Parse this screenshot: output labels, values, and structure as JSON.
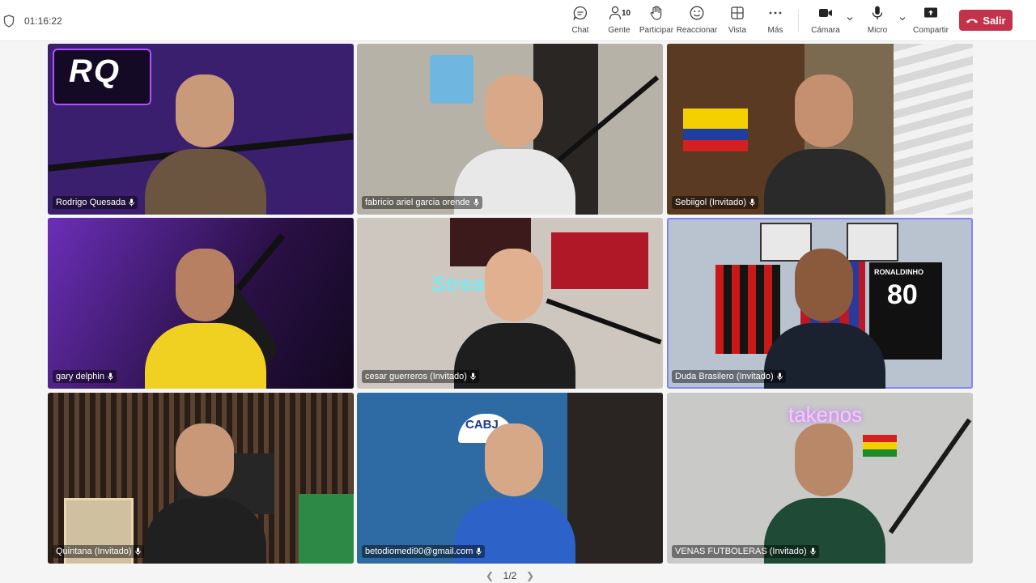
{
  "timer": "01:16:22",
  "toolbar": {
    "chat": "Chat",
    "people": "Gente",
    "people_count": "10",
    "raise": "Participar",
    "react": "Reaccionar",
    "view": "Vista",
    "more": "Más",
    "camera": "Cámara",
    "mic": "Micro",
    "share": "Compartir",
    "leave": "Salir"
  },
  "participants": [
    {
      "name": "Rodrigo Quesada",
      "bg": "#3a1f6e",
      "active": false
    },
    {
      "name": "fabricio ariel garcia orende",
      "bg": "#b7b2a7",
      "active": false
    },
    {
      "name": "Sebiigol (Invitado)",
      "bg": "#7b6a4f",
      "active": false
    },
    {
      "name": "gary delphin",
      "bg": "#3b1c63",
      "active": true
    },
    {
      "name": "cesar guerreros (Invitado)",
      "bg": "#cdc7c0",
      "active": false
    },
    {
      "name": "Duda Brasilero (Invitado)",
      "bg": "#b9c3cf",
      "active": true
    },
    {
      "name": "Quintana (Invitado)",
      "bg": "#4a3a2e",
      "active": false
    },
    {
      "name": "betodiomedi90@gmail.com",
      "bg": "#2e5d88",
      "active": false
    },
    {
      "name": "VENAS FUTBOLERAS (Invitado)",
      "bg": "#c9cac8",
      "active": false
    }
  ],
  "tile_text": {
    "t1_logo": "RQ",
    "t5_sign": "Stream",
    "t6_jersey_name": "RONALDINHO",
    "t6_jersey_number": "80",
    "t8_cap": "CABJ",
    "t9_sign": "takenos"
  },
  "pager": {
    "label": "1/2"
  },
  "colors": {
    "accent": "#7f85f5",
    "leave": "#c4314b"
  }
}
